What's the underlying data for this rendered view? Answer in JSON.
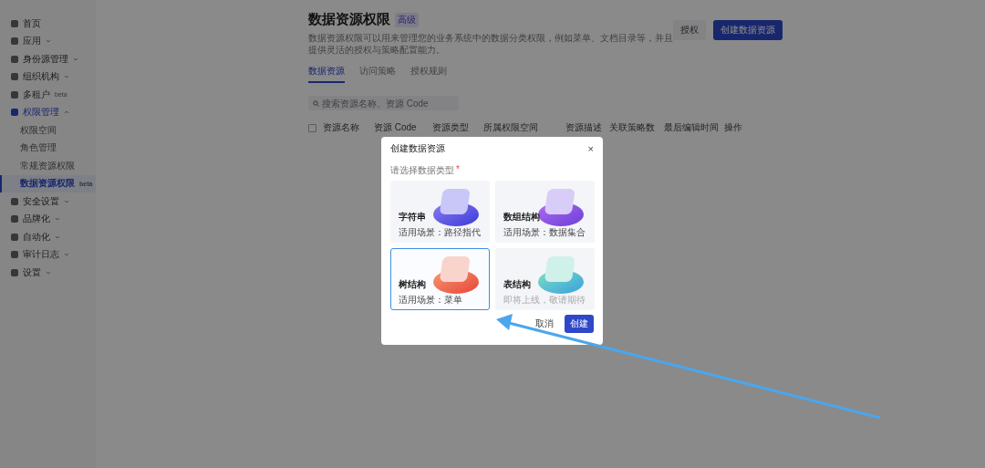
{
  "sidebar": {
    "items": [
      {
        "label": "首页",
        "selected": false
      },
      {
        "label": "应用",
        "selected": false,
        "expanded": false
      },
      {
        "label": "身份源管理",
        "selected": false,
        "expanded": false
      },
      {
        "label": "组织机构",
        "selected": false,
        "expanded": false
      },
      {
        "label": "多租户",
        "badge": "beta",
        "selected": false
      },
      {
        "label": "权限管理",
        "selected": false,
        "expanded": true,
        "children": [
          {
            "label": "权限空间",
            "selected": false
          },
          {
            "label": "角色管理",
            "selected": false
          },
          {
            "label": "常规资源权限",
            "selected": false
          },
          {
            "label": "数据资源权限",
            "badge": "beta",
            "selected": true
          }
        ]
      },
      {
        "label": "安全设置",
        "selected": false,
        "expanded": false
      },
      {
        "label": "品牌化",
        "selected": false,
        "expanded": false
      },
      {
        "label": "自动化",
        "selected": false,
        "expanded": false
      },
      {
        "label": "审计日志",
        "selected": false,
        "expanded": false
      },
      {
        "label": "设置",
        "selected": false,
        "expanded": false
      }
    ]
  },
  "page": {
    "title": "数据资源权限",
    "badge": "高级",
    "description": "数据资源权限可以用来管理您的业务系统中的数据分类权限，例如菜单、文档目录等，并且提供灵活的授权与策略配置能力。",
    "buttons": [
      {
        "label": "授权",
        "kind": "secondary"
      },
      {
        "label": "创建数据资源",
        "kind": "primary"
      }
    ],
    "tabs": [
      {
        "label": "数据资源",
        "selected": true
      },
      {
        "label": "访问策略",
        "selected": false
      },
      {
        "label": "授权规则",
        "selected": false
      }
    ],
    "search": {
      "placeholder": "搜索资源名称、资源 Code"
    },
    "table": {
      "select_all": {
        "checked": false
      },
      "columns": [
        "资源名称",
        "资源 Code",
        "资源类型",
        "所属权限空间",
        "资源描述",
        "关联策略数",
        "最后编辑时间",
        "操作"
      ]
    }
  },
  "dialog": {
    "title": "创建数据资源",
    "close": "×",
    "label": "请选择数据类型",
    "required_mark": "*",
    "options": [
      {
        "title": "字符串",
        "subtitle": "适用场景：路径指代",
        "selected": false,
        "disabled": false
      },
      {
        "title": "数组结构",
        "subtitle": "适用场景：数据集合",
        "selected": false,
        "disabled": false
      },
      {
        "title": "树结构",
        "subtitle": "适用场景：菜单",
        "selected": true,
        "disabled": false
      },
      {
        "title": "表结构",
        "subtitle": "即将上线，敬请期待",
        "selected": false,
        "disabled": true
      }
    ],
    "buttons": [
      {
        "label": "取消",
        "kind": "secondary"
      },
      {
        "label": "创建",
        "kind": "primary"
      }
    ]
  }
}
